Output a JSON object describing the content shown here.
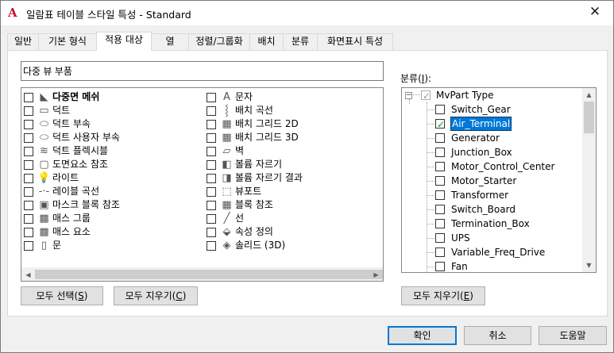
{
  "window": {
    "title": "일람표 테이블 스타일 특성 - Standard",
    "close_glyph": "✕",
    "app_icon_glyph": "A"
  },
  "tabs": [
    {
      "label": "일반"
    },
    {
      "label": "기본 형식"
    },
    {
      "label": "적용 대상",
      "active": true
    },
    {
      "label": "열"
    },
    {
      "label": "정렬/그룹화"
    },
    {
      "label": "배치"
    },
    {
      "label": "분류"
    },
    {
      "label": "화면표시 특성"
    }
  ],
  "apply_to": {
    "search_value": "다중 뷰 부품",
    "left_column": [
      {
        "label": "다중면 메쉬",
        "icon": "multiface-mesh-icon",
        "glyph": "◣"
      },
      {
        "label": "덕트",
        "icon": "duct-icon",
        "glyph": "▭"
      },
      {
        "label": "덕트 부속",
        "icon": "duct-fitting-icon",
        "glyph": "⬭"
      },
      {
        "label": "덕트 사용자 부속",
        "icon": "duct-custom-fitting-icon",
        "glyph": "⬭"
      },
      {
        "label": "덕트 플렉시블",
        "icon": "duct-flex-icon",
        "glyph": "≋"
      },
      {
        "label": "도면요소 참조",
        "icon": "element-reference-icon",
        "glyph": "▢"
      },
      {
        "label": "라이트",
        "icon": "light-icon",
        "glyph": "💡"
      },
      {
        "label": "레이블 곡선",
        "icon": "label-curve-icon",
        "glyph": "-·-"
      },
      {
        "label": "마스크 블록 참조",
        "icon": "mask-block-icon",
        "glyph": "▣"
      },
      {
        "label": "매스 그룹",
        "icon": "mass-group-icon",
        "glyph": "▩"
      },
      {
        "label": "매스 요소",
        "icon": "mass-element-icon",
        "glyph": "▩"
      },
      {
        "label": "문",
        "icon": "door-icon",
        "glyph": "▯"
      }
    ],
    "right_column": [
      {
        "label": "문자",
        "icon": "text-icon",
        "glyph": "A"
      },
      {
        "label": "배치 곡선",
        "icon": "layout-curve-icon",
        "glyph": "⸾"
      },
      {
        "label": "배치 그리드 2D",
        "icon": "layout-grid-2d-icon",
        "glyph": "▦"
      },
      {
        "label": "배치 그리드 3D",
        "icon": "layout-grid-3d-icon",
        "glyph": "▦"
      },
      {
        "label": "벽",
        "icon": "wall-icon",
        "glyph": "▱"
      },
      {
        "label": "볼륨 자르기",
        "icon": "volume-clip-icon",
        "glyph": "◧"
      },
      {
        "label": "볼륨 자르기 결과",
        "icon": "volume-clip-result-icon",
        "glyph": "◨"
      },
      {
        "label": "뷰포트",
        "icon": "viewport-icon",
        "glyph": "⬚"
      },
      {
        "label": "블록 참조",
        "icon": "block-reference-icon",
        "glyph": "▦"
      },
      {
        "label": "선",
        "icon": "line-icon",
        "glyph": "╱"
      },
      {
        "label": "속성 정의",
        "icon": "attribute-definition-icon",
        "glyph": "⬙"
      },
      {
        "label": "솔리드 (3D)",
        "icon": "solid-3d-icon",
        "glyph": "◈"
      }
    ],
    "select_all_label": "모두 선택(",
    "select_all_key": "S",
    "clear_all_label": "모두 지우기(",
    "clear_all_key": "C"
  },
  "classification": {
    "label": "분류(",
    "label_key": "I",
    "label_suffix": "):",
    "root": "MvPart Type",
    "items": [
      {
        "label": "Switch_Gear",
        "checked": false
      },
      {
        "label": "Air_Terminal",
        "checked": true,
        "selected": true
      },
      {
        "label": "Generator",
        "checked": false
      },
      {
        "label": "Junction_Box",
        "checked": false
      },
      {
        "label": "Motor_Control_Center",
        "checked": false
      },
      {
        "label": "Motor_Starter",
        "checked": false
      },
      {
        "label": "Transformer",
        "checked": false
      },
      {
        "label": "Switch_Board",
        "checked": false
      },
      {
        "label": "Termination_Box",
        "checked": false
      },
      {
        "label": "UPS",
        "checked": false
      },
      {
        "label": "Variable_Freq_Drive",
        "checked": false
      },
      {
        "label": "Fan",
        "checked": false
      }
    ],
    "clear_all_label": "모두 지우기(",
    "clear_all_key": "E"
  },
  "footer": {
    "ok_label": "확인",
    "cancel_label": "취소",
    "help_label": "도움말"
  },
  "colors": {
    "accent": "#0078d7",
    "check": "#2a8a2a",
    "app_icon": "#c8102e"
  }
}
